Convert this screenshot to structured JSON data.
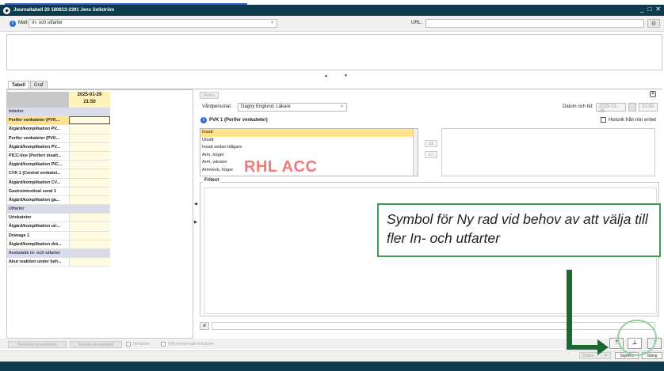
{
  "window": {
    "title": "Journaltabell 20 180813-2391 Jens Sellström",
    "controls": [
      "_",
      "□",
      "✕"
    ]
  },
  "mall": {
    "label": "Mall:",
    "value": "In- och utfarter",
    "url_label": "URL:",
    "url_value": ""
  },
  "tabs": [
    "Tabell",
    "Graf"
  ],
  "table": {
    "date": "2025-01-29",
    "time": "21:50",
    "rows": [
      {
        "label": "Infarter",
        "type": "group"
      },
      {
        "label": "Perifer venkateter (PVK...",
        "type": "selected"
      },
      {
        "label": "Åtgärd/komplikation PV...",
        "type": "item"
      },
      {
        "label": "Perifer venkateter (PVK...",
        "type": "item"
      },
      {
        "label": "Åtgärd/komplikation PV...",
        "type": "item"
      },
      {
        "label": "PICC-line (Perifert insatt...",
        "type": "item"
      },
      {
        "label": "Åtgärd/komplikation PIC...",
        "type": "item"
      },
      {
        "label": "CVK 1 (Central venkatet...",
        "type": "item"
      },
      {
        "label": "Åtgärd/komplikation CV...",
        "type": "item"
      },
      {
        "label": "Gastrointestinal sond 1",
        "type": "item"
      },
      {
        "label": "Åtgärd/komplikation ga...",
        "type": "item"
      },
      {
        "label": "Utfarter",
        "type": "group"
      },
      {
        "label": "Urinkateter",
        "type": "item"
      },
      {
        "label": "Åtgärd/komplikation uri...",
        "type": "item"
      },
      {
        "label": "Dränage 1",
        "type": "item"
      },
      {
        "label": "Åtgärd/komplikation drä...",
        "type": "item"
      },
      {
        "label": "Avslutade in- och utfarter",
        "type": "group"
      },
      {
        "label": "Akut reaktion under beh...",
        "type": "item"
      }
    ]
  },
  "detail": {
    "andra_label": "Ändra",
    "vardpersonal_label": "Vårdpersonal:",
    "vardpersonal_value": "Dagny Englund, Läkare",
    "datum_label": "Datum och tid:",
    "datum_value": "2025-01-29",
    "tid_value": "21:50",
    "item_title": "PVK 1 (Perifer venkateter)",
    "historik_label": "Historik från min enhet",
    "options": [
      "Insatt",
      "Utsatt",
      "Insatt sedan tidigare",
      "Arm, höger",
      "Arm, vänster",
      "Armveck, höger"
    ],
    "selected_option": "Insatt",
    "fritext_label": "Fritext",
    "watermark": "RHL ACC"
  },
  "footer": {
    "makulera_label": "Makulera journaltabell",
    "avsluta_label": "Avsluta journaltabell",
    "versioner_label": "Versioner",
    "dolj_label": "Dölj makulerade kolumner",
    "status_label": "Status",
    "signera_label": "Signera",
    "stang_label": "Stäng"
  },
  "annotation": {
    "text": "Symbol för Ny rad vid behov av att välja till fler In- och utfarter",
    "color": "#3e9c55",
    "arrow_color": "#1a6a2f"
  },
  "icons": {
    "app": "app-logo-icon",
    "info": "info-icon",
    "gear": "gear-icon",
    "calendar": "calendar-icon",
    "attach": "paperclip-icon",
    "new_row": "new-row-icon"
  }
}
